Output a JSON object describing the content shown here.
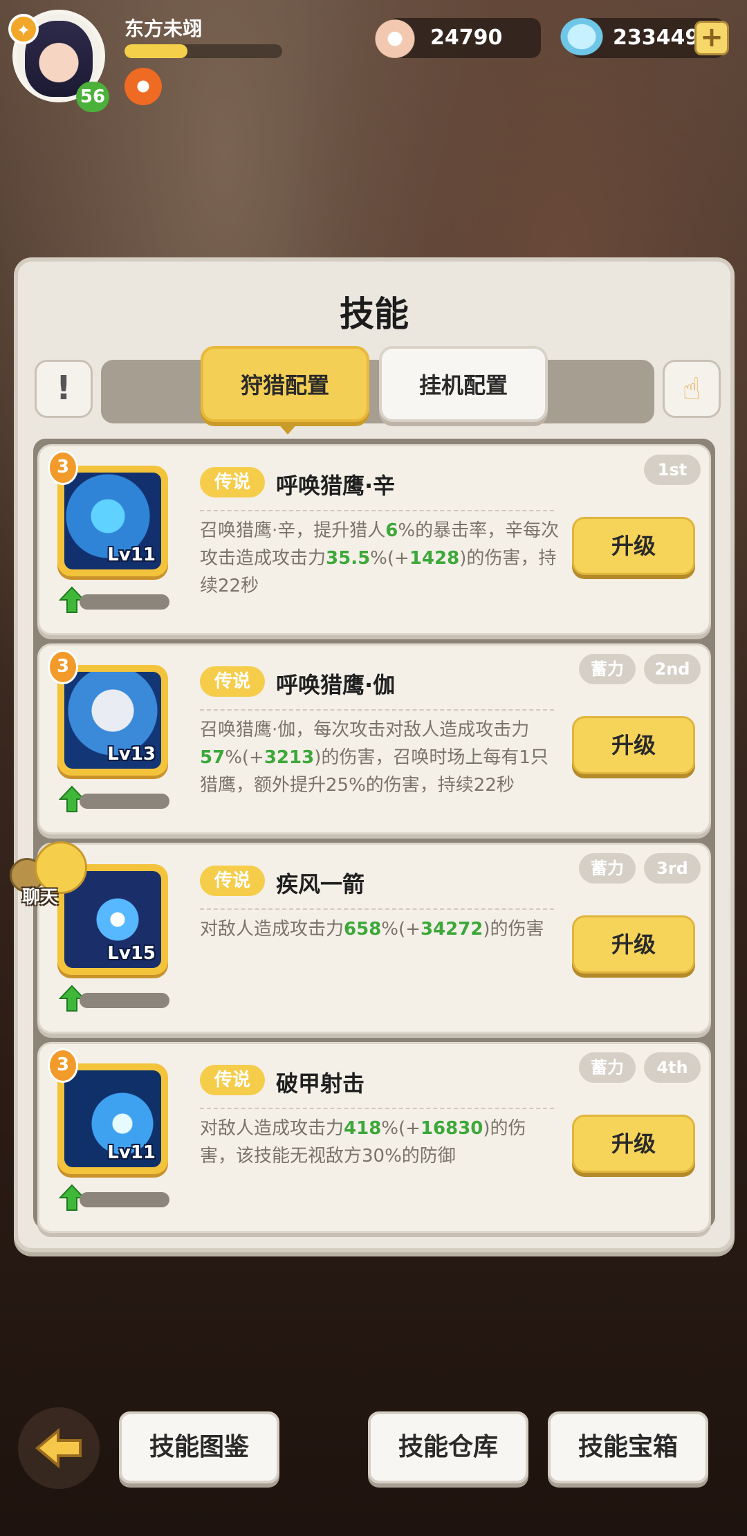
{
  "player": {
    "name": "东方未翊",
    "level": "56",
    "exp_fraction": 0.4
  },
  "resources": {
    "shells": "24790",
    "gems": "233449"
  },
  "panel": {
    "title": "技能",
    "tabs": [
      {
        "label": "狩猎配置",
        "active": true
      },
      {
        "label": "挂机配置",
        "active": false
      }
    ]
  },
  "skills": [
    {
      "rarity": "传说",
      "name": "呼唤猎鹰·辛",
      "level": "Lv11",
      "stars": "3",
      "order": "1st",
      "charge": "",
      "desc": [
        {
          "t": "召唤猎鹰·辛，提升猎人"
        },
        {
          "t": "6",
          "hl": true
        },
        {
          "t": "%的暴击率，辛每次攻击造成攻击力"
        },
        {
          "t": "35.5",
          "hl": true
        },
        {
          "t": "%(+"
        },
        {
          "t": "1428",
          "hl": true
        },
        {
          "t": ")的伤害，持续22秒"
        }
      ],
      "button": "升级"
    },
    {
      "rarity": "传说",
      "name": "呼唤猎鹰·伽",
      "level": "Lv13",
      "stars": "3",
      "order": "2nd",
      "charge": "蓄力",
      "desc": [
        {
          "t": "召唤猎鹰·伽，每次攻击对敌人造成攻击力"
        },
        {
          "t": "57",
          "hl": true
        },
        {
          "t": "%(+"
        },
        {
          "t": "3213",
          "hl": true
        },
        {
          "t": ")的伤害，召唤时场上每有1只猎鹰，额外提升25%的伤害，持续22秒"
        }
      ],
      "button": "升级"
    },
    {
      "rarity": "传说",
      "name": "疾风一箭",
      "level": "Lv15",
      "stars": "",
      "order": "3rd",
      "charge": "蓄力",
      "desc": [
        {
          "t": "对敌人造成攻击力"
        },
        {
          "t": "658",
          "hl": true
        },
        {
          "t": "%(+"
        },
        {
          "t": "34272",
          "hl": true
        },
        {
          "t": ")的伤害"
        }
      ],
      "button": "升级"
    },
    {
      "rarity": "传说",
      "name": "破甲射击",
      "level": "Lv11",
      "stars": "3",
      "order": "4th",
      "charge": "蓄力",
      "desc": [
        {
          "t": "对敌人造成攻击力"
        },
        {
          "t": "418",
          "hl": true
        },
        {
          "t": "%(+"
        },
        {
          "t": "16830",
          "hl": true
        },
        {
          "t": ")的伤害，该技能无视敌方30%的防御"
        }
      ],
      "button": "升级"
    }
  ],
  "chat": {
    "label": "聊天"
  },
  "bottom": {
    "codex": "技能图鉴",
    "storage": "技能仓库",
    "chest": "技能宝箱"
  },
  "colors": {
    "accent_yellow": "#f4cf55",
    "highlight_green": "#3da83a",
    "panel_bg": "#ebe6de"
  }
}
